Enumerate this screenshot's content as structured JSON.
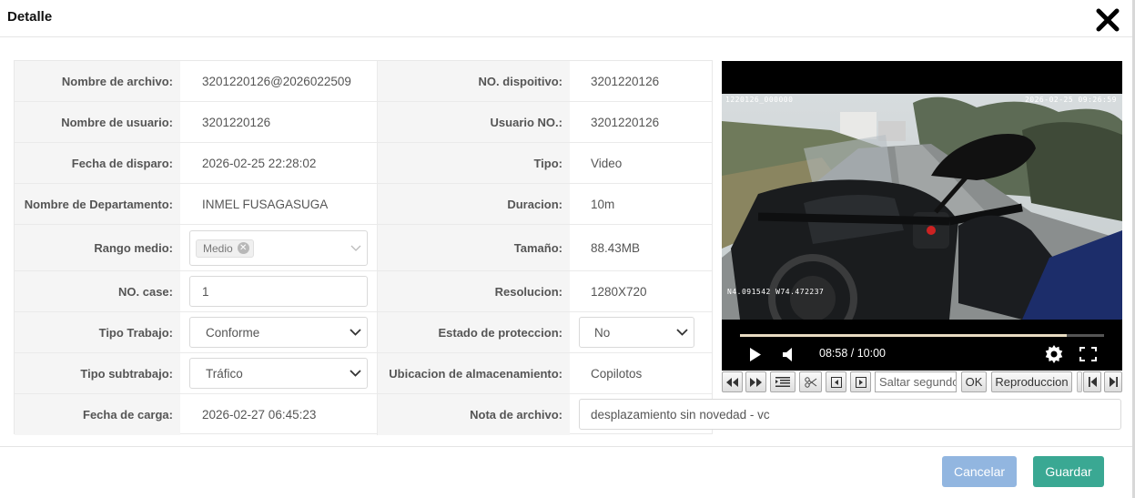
{
  "modal": {
    "title": "Detalle",
    "close_icon": "close-icon"
  },
  "fields": {
    "nombre_archivo": {
      "label": "Nombre de archivo:",
      "value": "3201220126@2026022509"
    },
    "no_dispositivo": {
      "label": "NO. dispoitivo:",
      "value": "3201220126"
    },
    "nombre_usuario": {
      "label": "Nombre de usuario:",
      "value": "3201220126"
    },
    "usuario_no": {
      "label": "Usuario NO.:",
      "value": "3201220126"
    },
    "fecha_disparo": {
      "label": "Fecha de disparo:",
      "value": "2026-02-25 22:28:02"
    },
    "tipo": {
      "label": "Tipo:",
      "value": "Video"
    },
    "departamento": {
      "label": "Nombre de Departamento:",
      "value": "INMEL FUSAGASUGA"
    },
    "duracion": {
      "label": "Duracion:",
      "value": "10m"
    },
    "rango_medio": {
      "label": "Rango medio:",
      "tag": "Medio"
    },
    "tamano": {
      "label": "Tamaño:",
      "value": "88.43MB"
    },
    "no_case": {
      "label": "NO. case:",
      "value": "1"
    },
    "resolucion": {
      "label": "Resolucion:",
      "value": "1280X720"
    },
    "tipo_trabajo": {
      "label": "Tipo Trabajo:",
      "value": "Conforme"
    },
    "estado_proteccion": {
      "label": "Estado de proteccion:",
      "value": "No"
    },
    "tipo_subtrabajo": {
      "label": "Tipo subtrabajo:",
      "value": "Tráfico"
    },
    "ubicacion": {
      "label": "Ubicacion de almacenamiento:",
      "value": "Copilotos"
    },
    "fecha_carga": {
      "label": "Fecha de carga:",
      "value": "2026-02-27 06:45:23"
    },
    "nota_archivo": {
      "label": "Nota de archivo:",
      "value": "desplazamiento sin novedad - vc"
    }
  },
  "video": {
    "osd_device": "1220126_000000",
    "osd_datetime": "2026-02-25  09:26:59",
    "osd_gps": "N4.091542  W74.472237",
    "current_time": "08:58 / 10:00",
    "progress_fraction": 0.897
  },
  "toolbar": {
    "seek_placeholder": "Saltar segundos",
    "ok_label": "OK",
    "playback_label": "Reproduccion"
  },
  "footer": {
    "cancel_label": "Cancelar",
    "save_label": "Guardar"
  },
  "colors": {
    "cancel": "#92b6e0",
    "save": "#3aa893"
  }
}
